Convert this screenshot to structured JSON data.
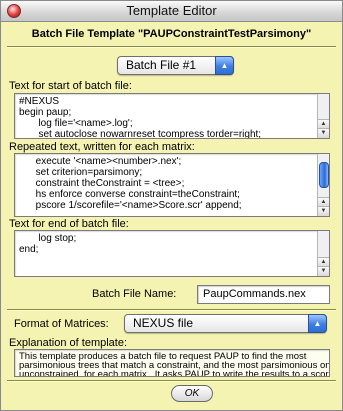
{
  "window": {
    "title": "Template Editor"
  },
  "header": {
    "title": "Batch File Template \"PAUPConstraintTestParsimony\""
  },
  "batch_select": {
    "value": "Batch File #1",
    "arrow_icon": "popup-arrows-icon"
  },
  "start_section": {
    "label": "Text for start of batch file:",
    "text": "#NEXUS\nbegin paup;\n       log file='<name>.log';\n       set autoclose nowarnreset tcompress torder=right;"
  },
  "repeat_section": {
    "label": "Repeated text, written for each matrix:",
    "text": "      execute '<name><number>.nex';\n      set criterion=parsimony;\n      constraint theConstraint = <tree>;\n      hs enforce converse constraint=theConstraint;\n      pscore 1/scorefile='<name>Score.scr' append;"
  },
  "end_section": {
    "label": "Text for end of batch file:",
    "text": "       log stop;\nend;"
  },
  "batch_file_name": {
    "label": "Batch File Name:",
    "value": "PaupCommands.nex"
  },
  "format": {
    "label": "Format of Matrices:",
    "value": "NEXUS file"
  },
  "explanation": {
    "label": "Explanation of template:",
    "text": "This template produces a batch file to request PAUP to find the most\nparsimonious trees that match a constraint, and the most parsimonious ones\nunconstrained, for each matrix.  It asks PAUP to write the results to a score file."
  },
  "ok_button": {
    "label": "OK"
  },
  "colors": {
    "background": "#f4f3b2",
    "accent_blue": "#3e7fe0"
  }
}
